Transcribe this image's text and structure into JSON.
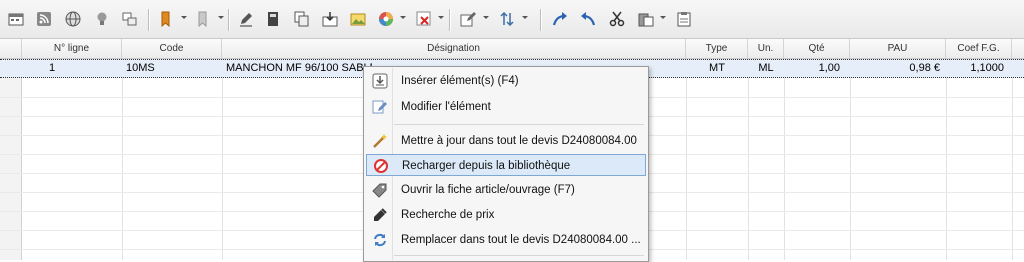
{
  "toolbar": {
    "icons": [
      "calendar-icon",
      "rss-icon",
      "globe-icon",
      "lightbulb-icon",
      "window-stack-icon",
      "bookmark-icon",
      "bookmark-grey-icon",
      "pencil-icon",
      "book-icon",
      "copy-icon",
      "import-icon",
      "picture-icon",
      "color-wheel-icon",
      "delete-table-icon",
      "edit-icon",
      "sort-icon",
      "redo-icon",
      "undo-icon",
      "cut-icon",
      "paste-icon",
      "clipboard-icon"
    ]
  },
  "table": {
    "columns": [
      "N° ligne",
      "Code",
      "Désignation",
      "Type",
      "Un.",
      "Qté",
      "PAU",
      "Coef F.G."
    ],
    "rows": [
      {
        "line": "1",
        "code": "10MS",
        "designation": "MANCHON MF 96/100 SABLE",
        "type": "MT",
        "unit": "ML",
        "qty": "1,00",
        "pau": "0,98 €",
        "coef": "1,1000"
      }
    ]
  },
  "context_menu": {
    "items": [
      {
        "label": "Insérer élément(s) (F4)",
        "icon": "insert-icon"
      },
      {
        "label": "Modifier l'élément",
        "icon": "edit-element-icon"
      },
      {
        "label": "Mettre à jour dans tout le devis D24080084.00",
        "icon": "magic-wand-icon"
      },
      {
        "label": "Recharger depuis la bibliothèque",
        "icon": "reload-forbidden-icon"
      },
      {
        "label": "Ouvrir la fiche article/ouvrage (F7)",
        "icon": "tag-icon"
      },
      {
        "label": "Recherche de prix",
        "icon": "price-search-icon"
      },
      {
        "label": "Remplacer dans tout le devis D24080084.00 ...",
        "icon": "replace-icon"
      }
    ],
    "highlighted_index": 3
  }
}
